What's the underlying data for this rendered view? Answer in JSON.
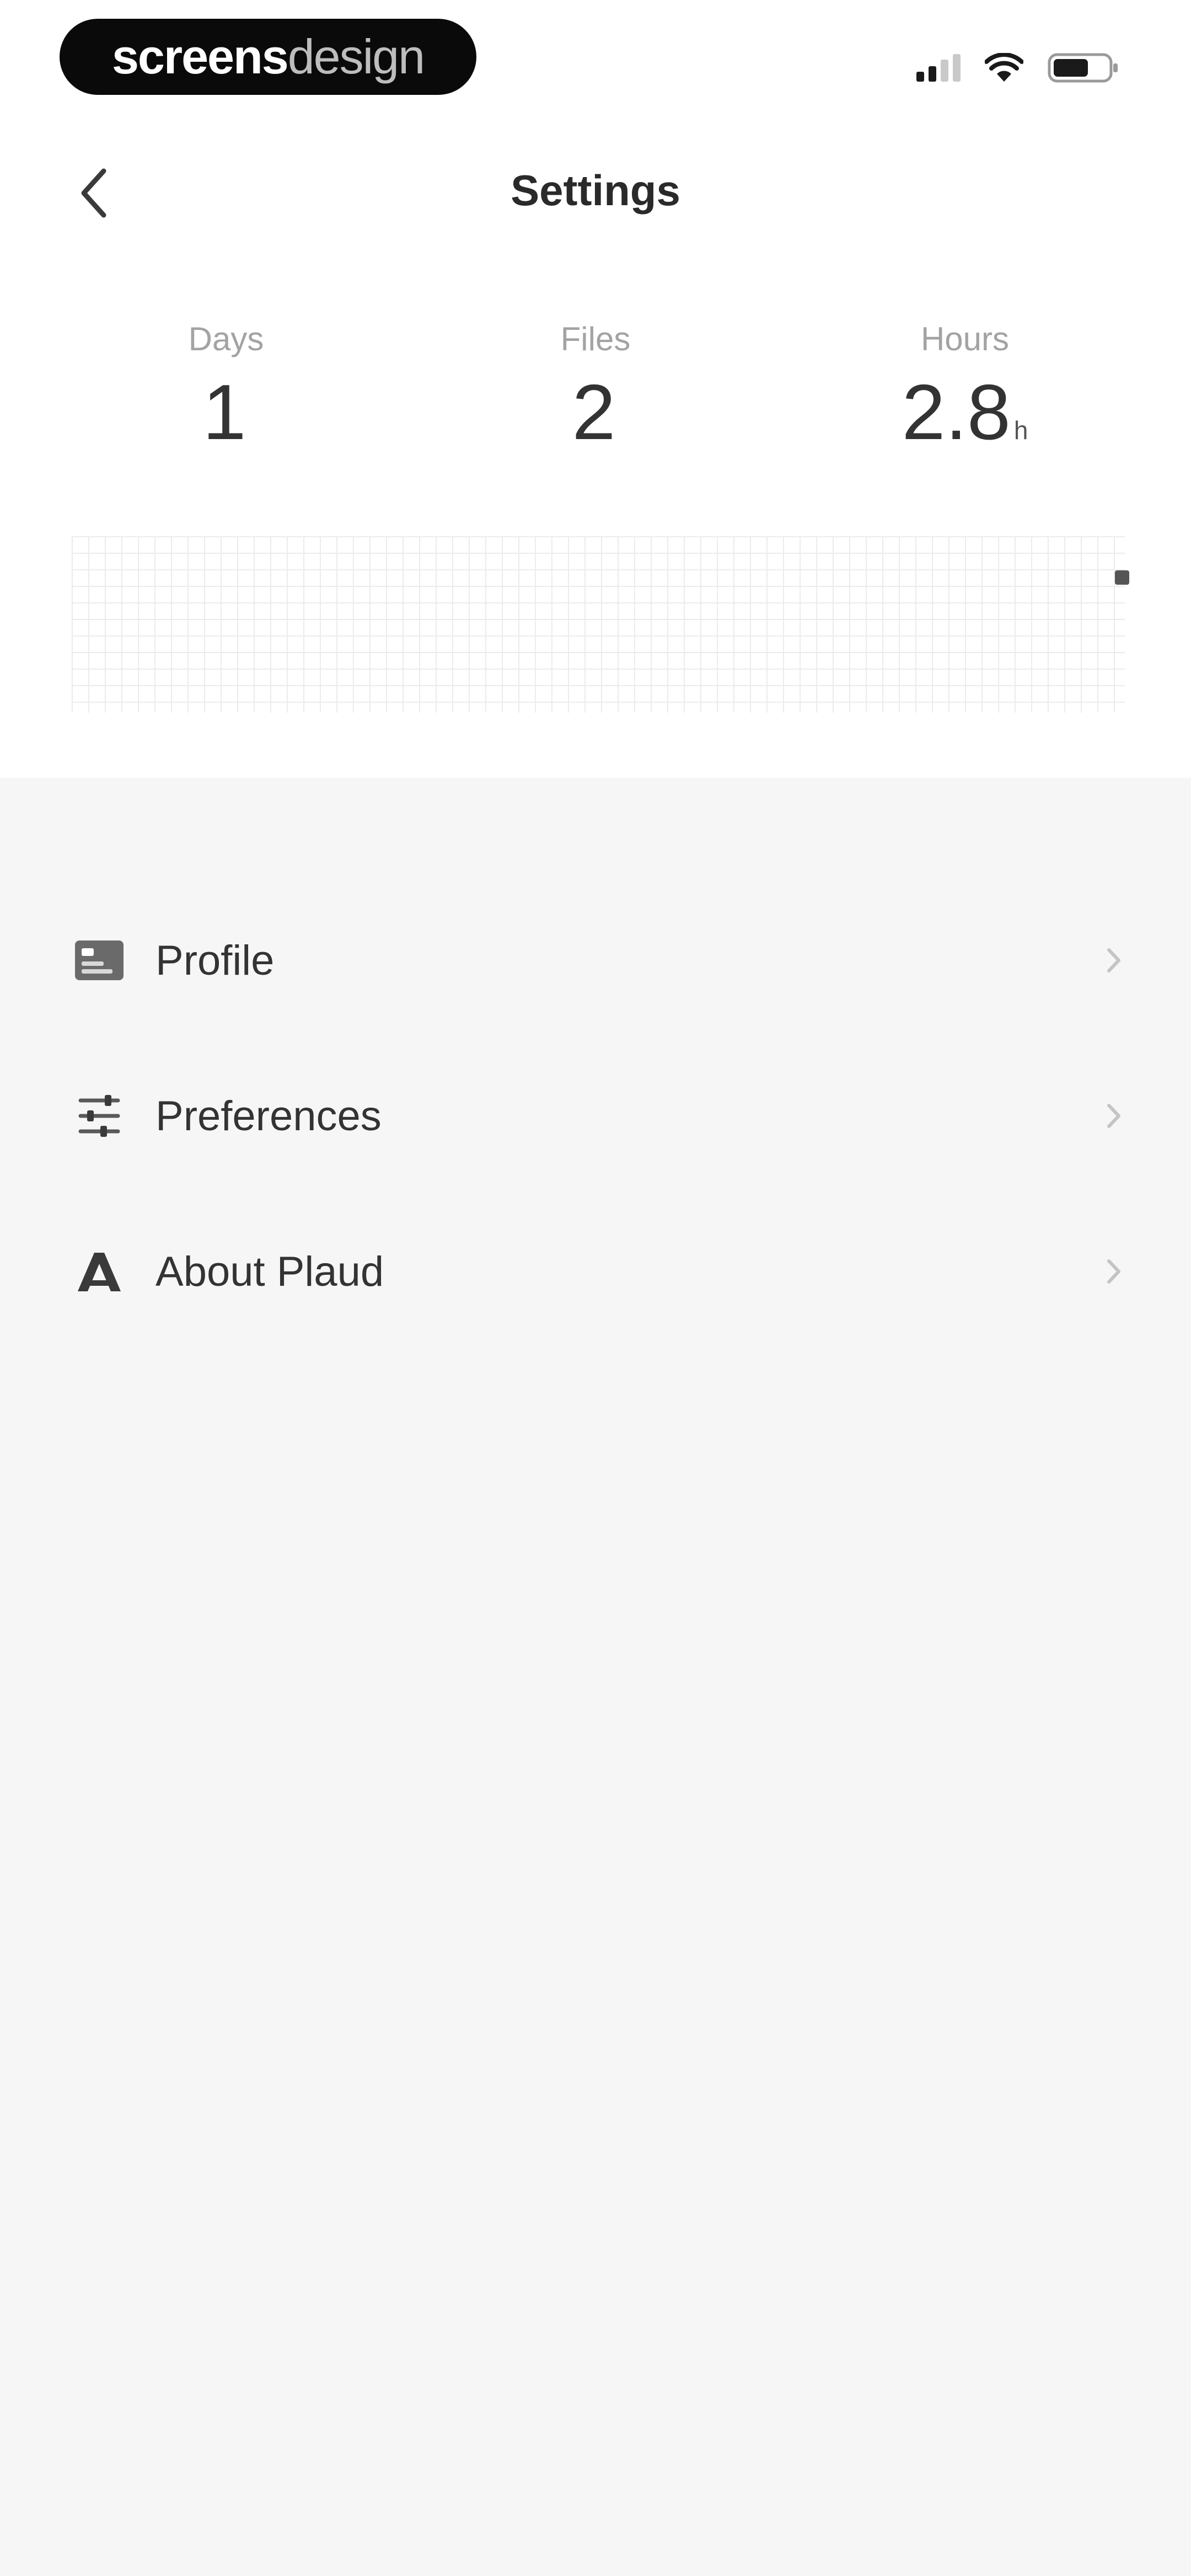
{
  "status_bar": {
    "badge_text_bold": "screens",
    "badge_text_light": "design",
    "icons": [
      "cellular-signal-icon",
      "wifi-icon",
      "battery-icon"
    ]
  },
  "nav": {
    "title": "Settings",
    "back_icon": "chevron-left-icon"
  },
  "stats": [
    {
      "label": "Days",
      "value": "1",
      "unit": ""
    },
    {
      "label": "Files",
      "value": "2",
      "unit": ""
    },
    {
      "label": "Hours",
      "value": "2.8",
      "unit": "h"
    }
  ],
  "activity_grid": {
    "active_cells": [
      {
        "col": 63,
        "row": 1
      }
    ]
  },
  "menu": {
    "items": [
      {
        "label": "Profile",
        "icon": "profile-card-icon"
      },
      {
        "label": "Preferences",
        "icon": "sliders-icon"
      },
      {
        "label": "About Plaud",
        "icon": "plaud-logo-icon"
      }
    ]
  },
  "colors": {
    "page_background": "#f6f6f6",
    "card_background": "#ffffff",
    "text_primary": "#2b2b2b",
    "text_muted": "#a3a3a3"
  }
}
